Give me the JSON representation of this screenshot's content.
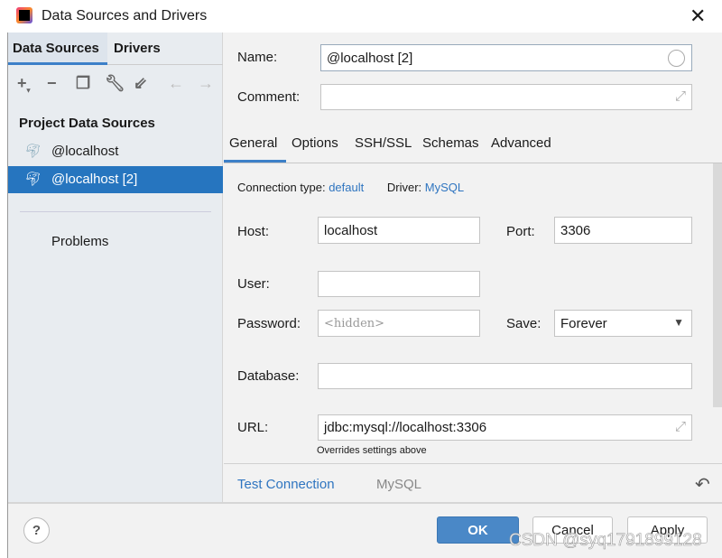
{
  "window": {
    "title": "Data Sources and Drivers"
  },
  "left": {
    "tabs": [
      {
        "label": "Data Sources",
        "selected": true
      },
      {
        "label": "Drivers",
        "selected": false
      }
    ],
    "toolbar": [
      "add-icon",
      "remove-icon",
      "duplicate-icon",
      "wrench-icon",
      "import-icon",
      "back-icon",
      "forward-icon"
    ],
    "section": "Project Data Sources",
    "items": [
      {
        "label": "@localhost",
        "selected": false
      },
      {
        "label": "@localhost [2]",
        "selected": true
      }
    ],
    "problems": "Problems"
  },
  "form": {
    "name_label": "Name:",
    "name_value": "@localhost [2]",
    "comment_label": "Comment:",
    "comment_value": ""
  },
  "tabs": [
    {
      "label": "General",
      "selected": true
    },
    {
      "label": "Options"
    },
    {
      "label": "SSH/SSL"
    },
    {
      "label": "Schemas"
    },
    {
      "label": "Advanced"
    }
  ],
  "general": {
    "conn_type_label": "Connection type:",
    "conn_type_value": "default",
    "driver_label": "Driver:",
    "driver_value": "MySQL",
    "host_label": "Host:",
    "host_value": "localhost",
    "port_label": "Port:",
    "port_value": "3306",
    "user_label": "User:",
    "user_value": "",
    "password_label": "Password:",
    "password_placeholder": "<hidden>",
    "save_label": "Save:",
    "save_value": "Forever",
    "database_label": "Database:",
    "database_value": "",
    "url_label": "URL:",
    "url_value": "jdbc:mysql://localhost:3306",
    "url_hint": "Overrides settings above"
  },
  "footer": {
    "test_connection": "Test Connection",
    "driver": "MySQL",
    "ok": "OK",
    "cancel": "Cancel",
    "apply": "Apply",
    "help": "?"
  },
  "watermark": "CSDN @syq1791899128",
  "colors": {
    "accent": "#2f75c0",
    "selection": "#2675bf",
    "ok": "#4a88c7"
  }
}
